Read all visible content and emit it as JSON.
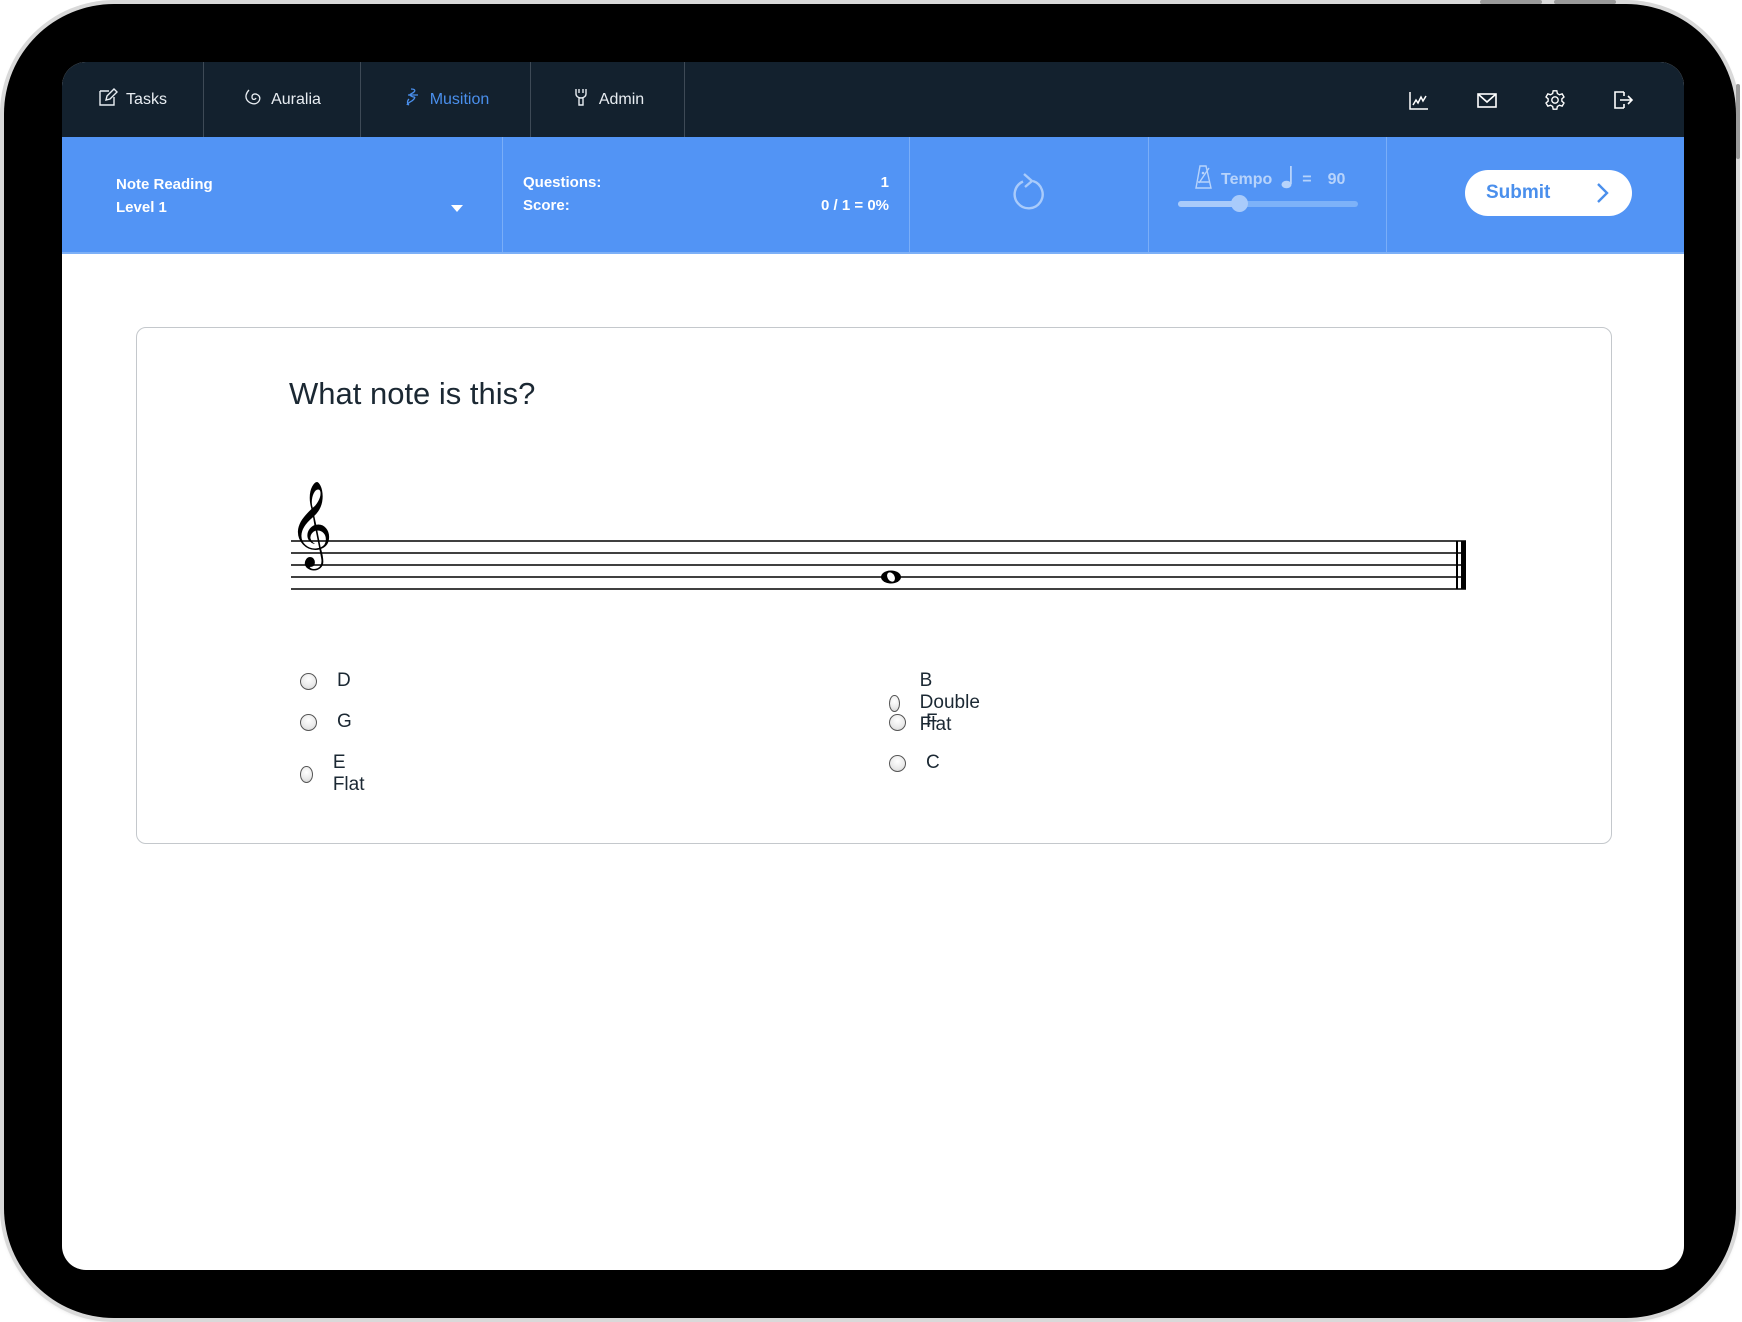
{
  "nav": {
    "tabs": [
      {
        "label": "Tasks",
        "icon": "edit-icon",
        "active": false
      },
      {
        "label": "Auralia",
        "icon": "ear-icon",
        "active": false
      },
      {
        "label": "Musition",
        "icon": "musition-icon",
        "active": true
      },
      {
        "label": "Admin",
        "icon": "wrench-icon",
        "active": false
      }
    ],
    "right_icons": [
      "chart-icon",
      "mail-icon",
      "gear-icon",
      "logout-icon"
    ]
  },
  "toolbar": {
    "topic": "Note Reading",
    "level": "Level 1",
    "questions_label": "Questions:",
    "questions_value": "1",
    "score_label": "Score:",
    "score_value": "0 / 1 = 0%",
    "replay_icon": "replay-icon",
    "tempo_label": "Tempo",
    "tempo_equals": "=",
    "tempo_value": "90",
    "tempo_slider_fraction": 0.34,
    "submit_label": "Submit"
  },
  "question": {
    "prompt": "What note is this?",
    "clef": "treble",
    "note": {
      "duration": "whole",
      "staff_line_from_bottom": 2
    },
    "options": [
      {
        "label": "D",
        "selected": false
      },
      {
        "label": "G",
        "selected": false
      },
      {
        "label": "E Flat",
        "selected": false
      },
      {
        "label": "B Double Flat",
        "selected": false
      },
      {
        "label": "F",
        "selected": false
      },
      {
        "label": "C",
        "selected": false
      }
    ]
  },
  "colors": {
    "nav_bg": "#13212e",
    "toolbar_bg": "#5294f5",
    "accent": "#4a8fec",
    "text": "#1b2833"
  }
}
